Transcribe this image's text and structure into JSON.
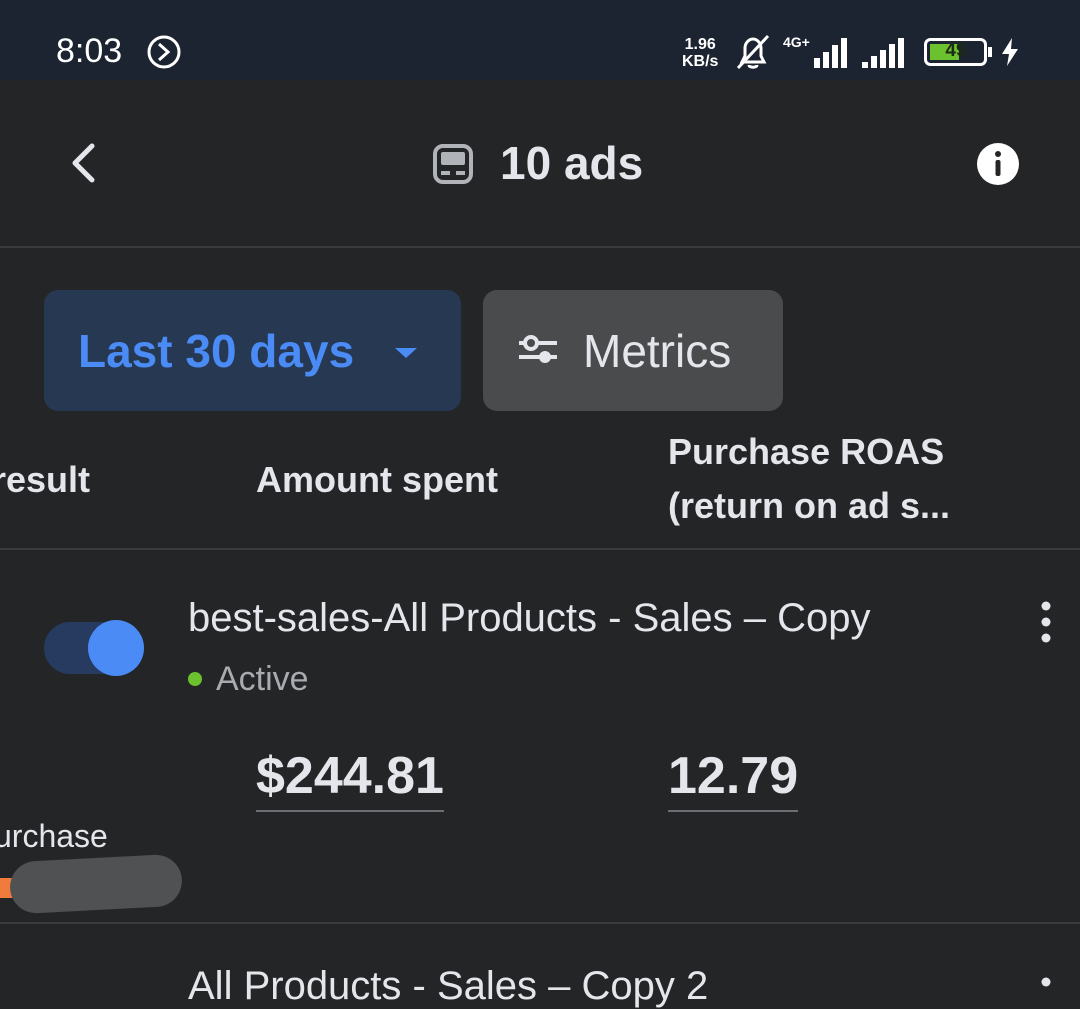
{
  "status_bar": {
    "time": "8:03",
    "net_speed_value": "1.96",
    "net_speed_unit": "KB/s",
    "network_type": "4G+",
    "battery_level": "49",
    "icons": [
      "clock-icon",
      "bell-off-icon",
      "signal-icon",
      "battery-icon",
      "charging-icon"
    ]
  },
  "header": {
    "title": "10 ads",
    "back_icon": "chevron-left-icon",
    "title_icon": "ad-icon",
    "info_icon": "info-icon"
  },
  "filters": {
    "date_range": "Last 30 days",
    "metrics_label": "Metrics"
  },
  "columns": {
    "result": "result",
    "amount_spent": "Amount spent",
    "roas": "Purchase ROAS (return on ad s..."
  },
  "rows": [
    {
      "name": "best-sales-All Products - Sales – Copy",
      "status": "Active",
      "toggle_on": true,
      "result_label": "urchase",
      "amount_spent": "$244.81",
      "roas": "12.79"
    }
  ],
  "next_row_partial": "All Products - Sales – Copy 2",
  "colors": {
    "background": "#242526",
    "accent": "#4b8bf5",
    "active": "#6cc12f"
  }
}
